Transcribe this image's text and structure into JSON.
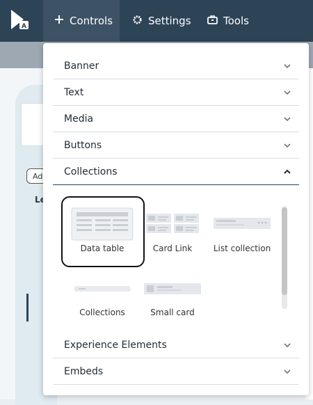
{
  "topbar": {
    "nav": [
      {
        "label": "Controls",
        "icon": "plus-icon"
      },
      {
        "label": "Settings",
        "icon": "gear-icon"
      },
      {
        "label": "Tools",
        "icon": "toolbox-icon"
      }
    ]
  },
  "background": {
    "pill_text": "Ad",
    "le_text": "Le"
  },
  "dropdown": {
    "sections": [
      {
        "label": "Banner",
        "state": "collapsed"
      },
      {
        "label": "Text",
        "state": "collapsed"
      },
      {
        "label": "Media",
        "state": "collapsed"
      },
      {
        "label": "Buttons",
        "state": "collapsed"
      },
      {
        "label": "Collections",
        "state": "expanded"
      }
    ],
    "collection_tiles": [
      {
        "label": "Data table",
        "selected": true
      },
      {
        "label": "Card Link"
      },
      {
        "label": "List collection"
      },
      {
        "label": "Collections"
      },
      {
        "label": "Small card"
      }
    ],
    "bottom_sections": [
      {
        "label": "Experience Elements",
        "state": "collapsed"
      },
      {
        "label": "Embeds",
        "state": "collapsed"
      }
    ]
  },
  "colors": {
    "topbar": "#2d4356",
    "accent": "#2d4356",
    "selection_border": "#111111"
  }
}
